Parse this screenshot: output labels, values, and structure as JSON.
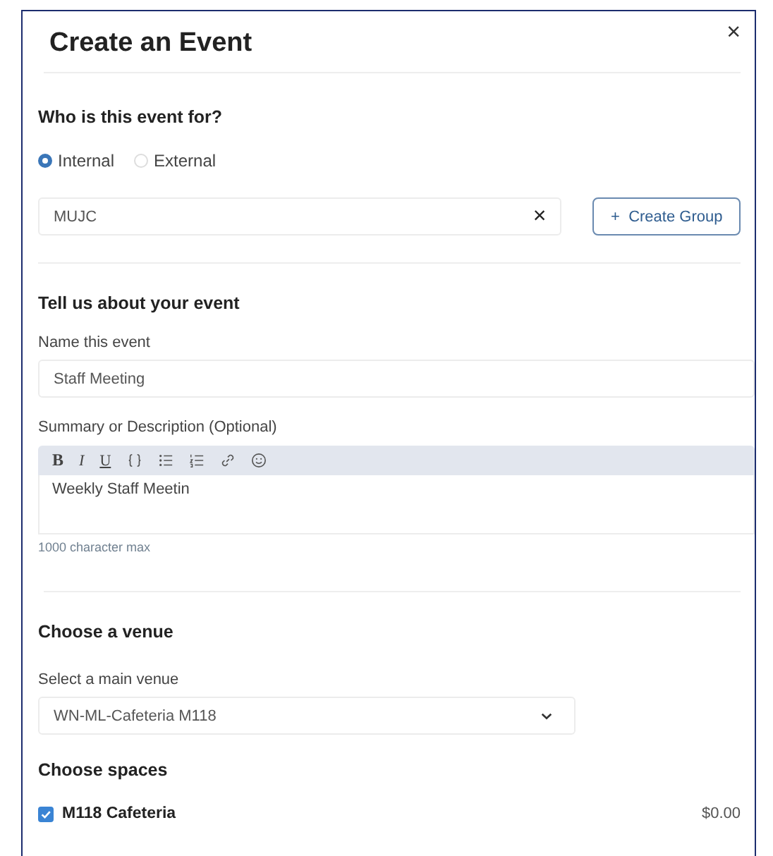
{
  "dialog": {
    "title": "Create an Event",
    "close": "×"
  },
  "audience": {
    "heading": "Who is this event for?",
    "options": [
      {
        "label": "Internal",
        "selected": true
      },
      {
        "label": "External",
        "selected": false
      }
    ],
    "group_value": "MUJC",
    "clear": "×",
    "create_button": "+  Create Group"
  },
  "details": {
    "heading": "Tell us about your event",
    "name_label": "Name this event",
    "name_value": "Staff Meeting",
    "summary_label": "Summary or Description (Optional)",
    "toolbar": [
      {
        "kind": "bold",
        "label": "B"
      },
      {
        "kind": "italic",
        "label": "I"
      },
      {
        "kind": "underline",
        "label": "U"
      },
      {
        "kind": "code"
      },
      {
        "kind": "bullets"
      },
      {
        "kind": "numbers"
      },
      {
        "kind": "link"
      },
      {
        "kind": "emoji"
      }
    ],
    "summary_value": "Weekly Staff Meetin",
    "hint": "1000 character max"
  },
  "venue": {
    "heading": "Choose a venue",
    "select_label": "Select a main venue",
    "select_value": "WN-ML-Cafeteria M118"
  },
  "spaces": {
    "heading": "Choose spaces",
    "items": [
      {
        "name": "M118 Cafeteria",
        "price": "$0.00",
        "checked": true
      }
    ]
  }
}
